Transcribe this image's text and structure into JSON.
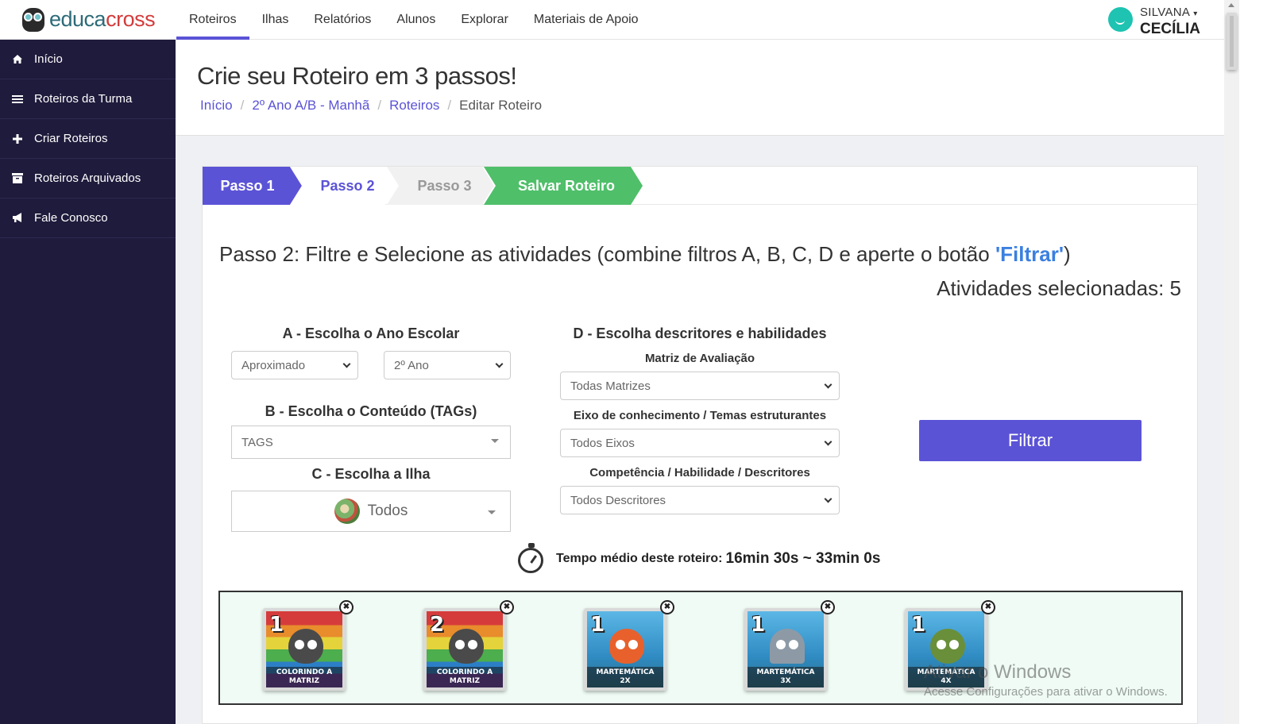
{
  "brand": {
    "name_part1": "educa",
    "name_part2": "cross"
  },
  "topnav": {
    "items": [
      {
        "label": "Roteiros",
        "active": true
      },
      {
        "label": "Ilhas"
      },
      {
        "label": "Relatórios"
      },
      {
        "label": "Alunos"
      },
      {
        "label": "Explorar"
      },
      {
        "label": "Materiais de Apoio"
      }
    ]
  },
  "user": {
    "first_name": "SILVANA",
    "last_name": "CECÍLIA",
    "avatar_color": "#1ec3b2"
  },
  "sidebar": {
    "items": [
      {
        "label": "Início",
        "icon": "home-icon"
      },
      {
        "label": "Roteiros da Turma",
        "icon": "list-icon"
      },
      {
        "label": "Criar Roteiros",
        "icon": "plus-icon"
      },
      {
        "label": "Roteiros Arquivados",
        "icon": "archive-icon"
      },
      {
        "label": "Fale Conosco",
        "icon": "megaphone-icon"
      }
    ]
  },
  "page": {
    "title": "Crie seu Roteiro em 3 passos!",
    "breadcrumb": {
      "home": "Início",
      "class": "2º Ano A/B - Manhã",
      "roteiros": "Roteiros",
      "current": "Editar Roteiro"
    }
  },
  "steps": [
    "Passo 1",
    "Passo 2",
    "Passo 3",
    "Salvar Roteiro"
  ],
  "step2": {
    "title_prefix": "Passo 2: Filtre e Selecione as atividades (combine filtros A, B, C, D e aperte o botão ",
    "title_highlight": "'Filtrar'",
    "title_suffix": ")",
    "selected_count": "Atividades selecionadas: 5"
  },
  "filters": {
    "a_label": "A - Escolha o Ano Escolar",
    "a_mode": "Aproximado",
    "a_year": "2º Ano",
    "b_label": "B - Escolha o Conteúdo (TAGs)",
    "b_placeholder": "TAGS",
    "c_label": "C - Escolha a Ilha",
    "c_value": "Todos",
    "d_label": "D - Escolha descritores e habilidades",
    "d_matrix_label": "Matriz de Avaliação",
    "d_matrix_value": "Todas Matrizes",
    "d_axis_label": "Eixo de conhecimento / Temas estruturantes",
    "d_axis_value": "Todos Eixos",
    "d_skill_label": "Competência / Habilidade / Descritores",
    "d_skill_value": "Todos Descritores",
    "button_label": "Filtrar"
  },
  "time": {
    "label": "Tempo médio deste roteiro:",
    "value": "16min 30s ~ 33min 0s"
  },
  "activities": [
    {
      "level": "1",
      "caption_l1": "COLORINDO A",
      "caption_l2": "MATRIZ",
      "theme": "rainbow"
    },
    {
      "level": "2",
      "caption_l1": "COLORINDO A",
      "caption_l2": "MATRIZ",
      "theme": "rainbow"
    },
    {
      "level": "1",
      "caption_l1": "MARTEMÁTICA",
      "caption_l2": "2X",
      "theme": "ocean"
    },
    {
      "level": "1",
      "caption_l1": "MARTEMÁTICA",
      "caption_l2": "3X",
      "theme": "ocean"
    },
    {
      "level": "1",
      "caption_l1": "MARTEMÁTICA",
      "caption_l2": "4X",
      "theme": "ocean"
    }
  ],
  "watermark": {
    "line1": "Ativar o Windows",
    "line2": "Acesse Configurações para ativar o Windows."
  },
  "colors": {
    "accent": "#5b53d6",
    "sidebar": "#1f1b3c",
    "save_green": "#4fbf6a",
    "highlight": "#3b7fe0"
  }
}
